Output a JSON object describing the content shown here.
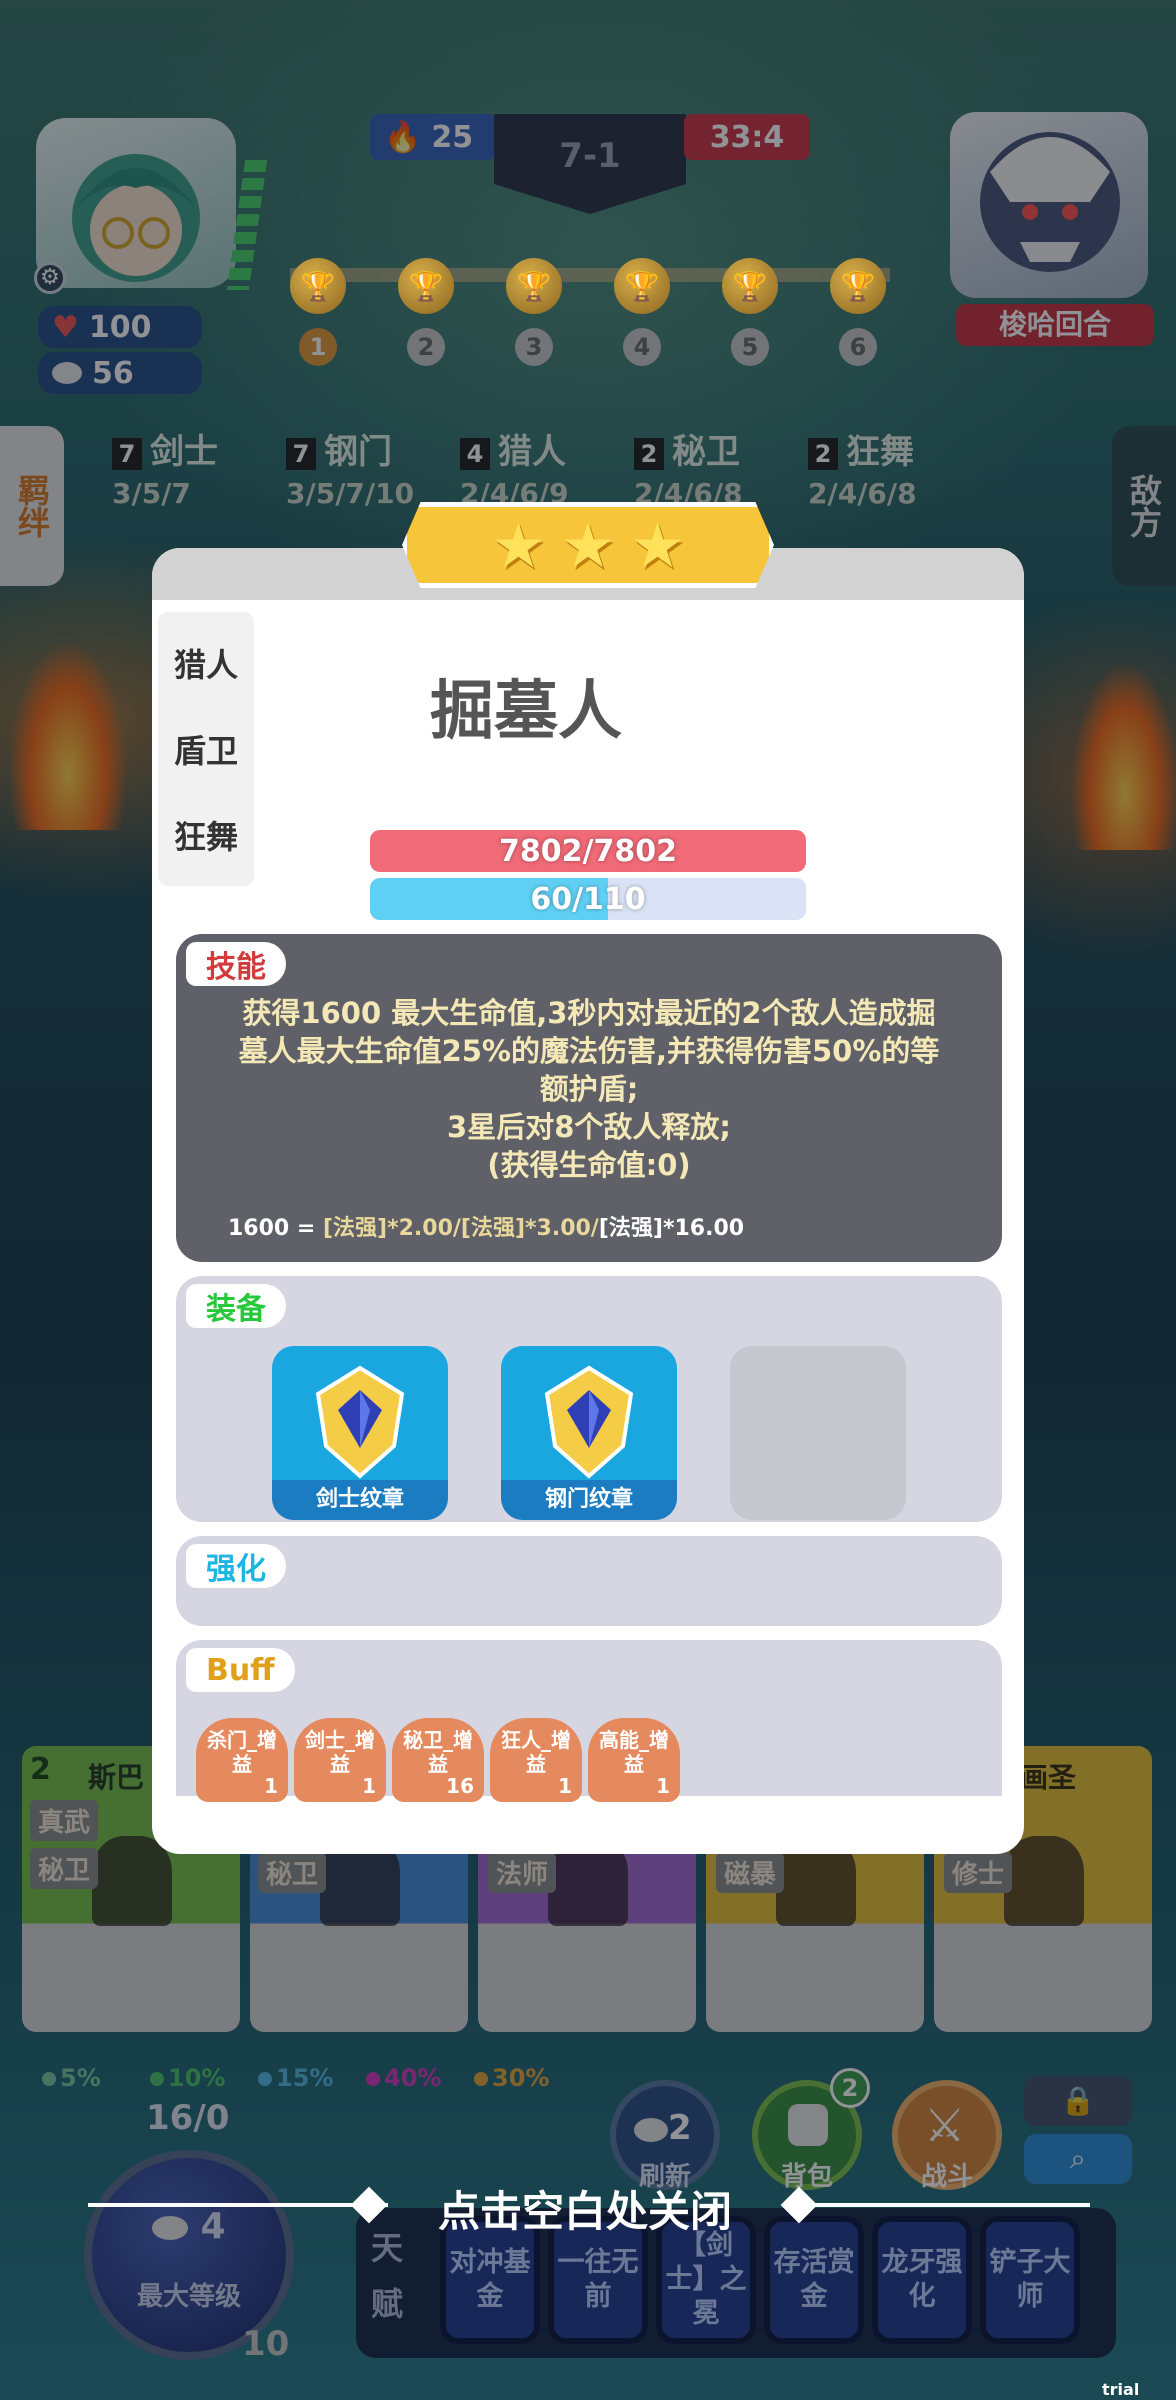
{
  "header": {
    "player_hp": "100",
    "player_gold": "56",
    "score_left": "25",
    "round": "7-1",
    "timer": "33:4",
    "opponent_label": "梭哈回合",
    "stages": [
      "1",
      "2",
      "3",
      "4",
      "5",
      "6"
    ]
  },
  "bonds": [
    {
      "count": "7",
      "name": "剑士",
      "tiers": "3/5/7"
    },
    {
      "count": "7",
      "name": "钢门",
      "tiers": "3/5/7/10"
    },
    {
      "count": "4",
      "name": "猎人",
      "tiers": "2/4/6/9"
    },
    {
      "count": "2",
      "name": "秘卫",
      "tiers": "2/4/6/8"
    },
    {
      "count": "2",
      "name": "狂舞",
      "tiers": "2/4/6/8"
    }
  ],
  "side_tabs": {
    "left": "羁绊",
    "right": "敌方"
  },
  "modal": {
    "stars": 3,
    "tags": [
      "猎人",
      "盾卫",
      "狂舞"
    ],
    "unit_name": "掘墓人",
    "hp_text": "7802/7802",
    "hp_fraction": 1.0,
    "mana_text": "60/110",
    "mana_fraction": 0.545,
    "skill": {
      "chip": "技能",
      "lines": [
        "获得1600 最大生命值,3秒内对最近的2个敌人造成掘",
        "墓人最大生命值25%的魔法伤害,并获得伤害50%的等",
        "额护盾;",
        "3星后对8个敌人释放;",
        "(获得生命值:0)"
      ],
      "formula_value": "1600 = ",
      "formula_a": "[法强]*2.00/[法强]*3.00/",
      "formula_b": "[法强]*16.00"
    },
    "equipment": {
      "chip": "装备",
      "items": [
        {
          "label": "剑士纹章"
        },
        {
          "label": "钢门纹章"
        }
      ]
    },
    "strengthen": {
      "chip": "强化"
    },
    "buffs": {
      "chip": "Buff",
      "items": [
        {
          "name": "杀门_增益",
          "value": "1"
        },
        {
          "name": "剑士_增益",
          "value": "1"
        },
        {
          "name": "秘卫_增益",
          "value": "16"
        },
        {
          "name": "狂人_增益",
          "value": "1"
        },
        {
          "name": "高能_增益",
          "value": "1"
        }
      ]
    }
  },
  "close_hint": "点击空白处关闭",
  "shop": {
    "odds": [
      "5%",
      "10%",
      "15%",
      "40%",
      "30%"
    ],
    "xp": "16/0",
    "level_cost": "4",
    "level_label": "最大等级",
    "level": "10",
    "refresh_label": "刷新",
    "refresh_cost": "2",
    "bag_label": "背包",
    "bag_badge": "2",
    "fight_label": "战斗",
    "talent_label": "天赋",
    "talents": [
      "对冲基金",
      "一往无前",
      "【剑士】之冕",
      "存活赏金",
      "龙牙强化",
      "铲子大师"
    ],
    "card_tags": [
      "真武",
      "秘卫",
      "秘卫",
      "法师",
      "磁暴",
      "修士"
    ],
    "card_names": [
      "斯巴",
      "画圣"
    ],
    "card_cost": "2"
  },
  "watermark": "trial version",
  "colors": {
    "hp": "#f06a78",
    "mana": "#5fd0f4",
    "skill_bg": "#5f6068",
    "section_bg": "#d6d6e2",
    "buff": "#e48a5e",
    "equip": "#1aa7e0"
  }
}
